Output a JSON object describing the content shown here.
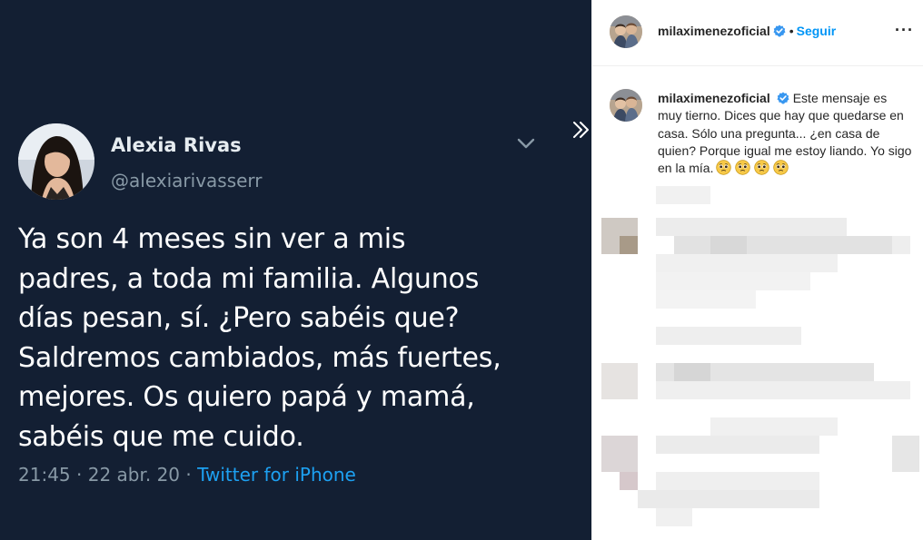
{
  "tweet": {
    "author_name": "Alexia Rivas",
    "author_handle": "@alexiarivasserr",
    "text_lines": [
      "Ya son 4 meses sin ver a mis",
      "padres, a toda mi familia. Algunos",
      "días pesan, sí. ¿Pero sabéis que?",
      "Saldremos cambiados, más fuertes,",
      "mejores. Os quiero papá y mamá,",
      "sabéis que me cuido."
    ],
    "time": "21:45",
    "separator": "·",
    "date": "22 abr. 20",
    "source": "Twitter for iPhone",
    "background": "#131f33",
    "accent": "#1da1f2"
  },
  "post": {
    "header": {
      "username": "milaximenezoficial",
      "dot": "•",
      "follow_label": "Seguir",
      "more_label": "···",
      "verified_icon": "verified-badge-icon"
    },
    "caption": {
      "username": "milaximenezoficial",
      "text": "Este mensaje es muy tierno. Dices que hay que quedarse en casa. Sólo una pregunta... ¿en casa de quien? Porque igual me estoy liando. Yo sigo en la mía.",
      "emojis": [
        "pleading-face-icon",
        "pleading-face-icon",
        "pleading-face-icon",
        "pleading-face-icon"
      ]
    },
    "comments_state": "pixelated",
    "follow_color": "#0095f6"
  }
}
